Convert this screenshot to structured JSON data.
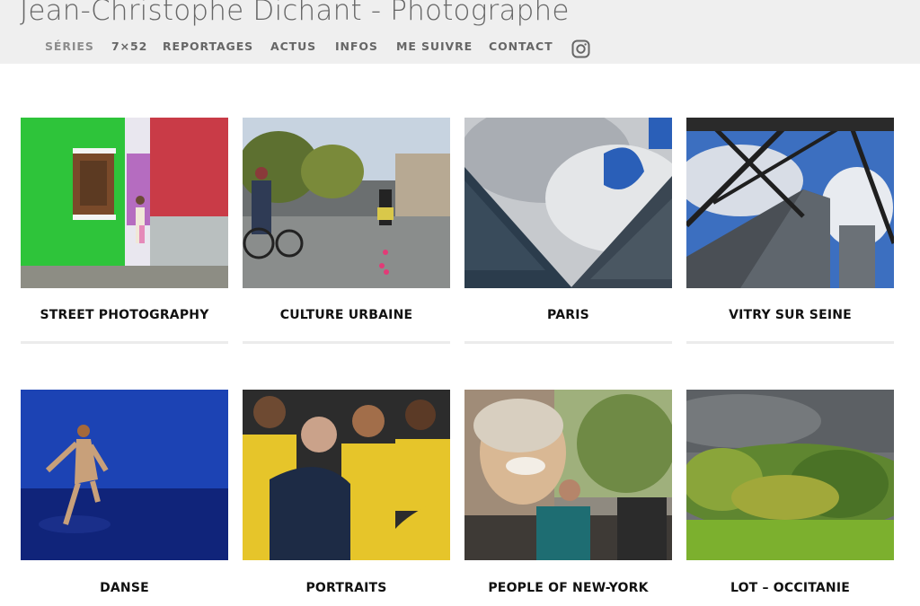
{
  "header": {
    "site_title": "Jean-Christophe Dichant - Photographe",
    "nav": [
      {
        "label": "SÉRIES",
        "active": true
      },
      {
        "label": "7×52"
      },
      {
        "label": "REPORTAGES"
      },
      {
        "label": "ACTUS"
      },
      {
        "label": "INFOS"
      },
      {
        "label": "ME SUIVRE"
      },
      {
        "label": "CONTACT"
      }
    ],
    "social_icon": "instagram-icon"
  },
  "gallery": [
    {
      "title": "STREET PHOTOGRAPHY"
    },
    {
      "title": "CULTURE URBAINE"
    },
    {
      "title": "PARIS"
    },
    {
      "title": "VITRY SUR SEINE"
    },
    {
      "title": "DANSE"
    },
    {
      "title": "PORTRAITS"
    },
    {
      "title": "PEOPLE OF NEW-YORK"
    },
    {
      "title": "LOT – OCCITANIE"
    }
  ],
  "colors": {
    "header_bg": "#efefef",
    "title_text": "#666666",
    "caption_text": "#111111"
  }
}
